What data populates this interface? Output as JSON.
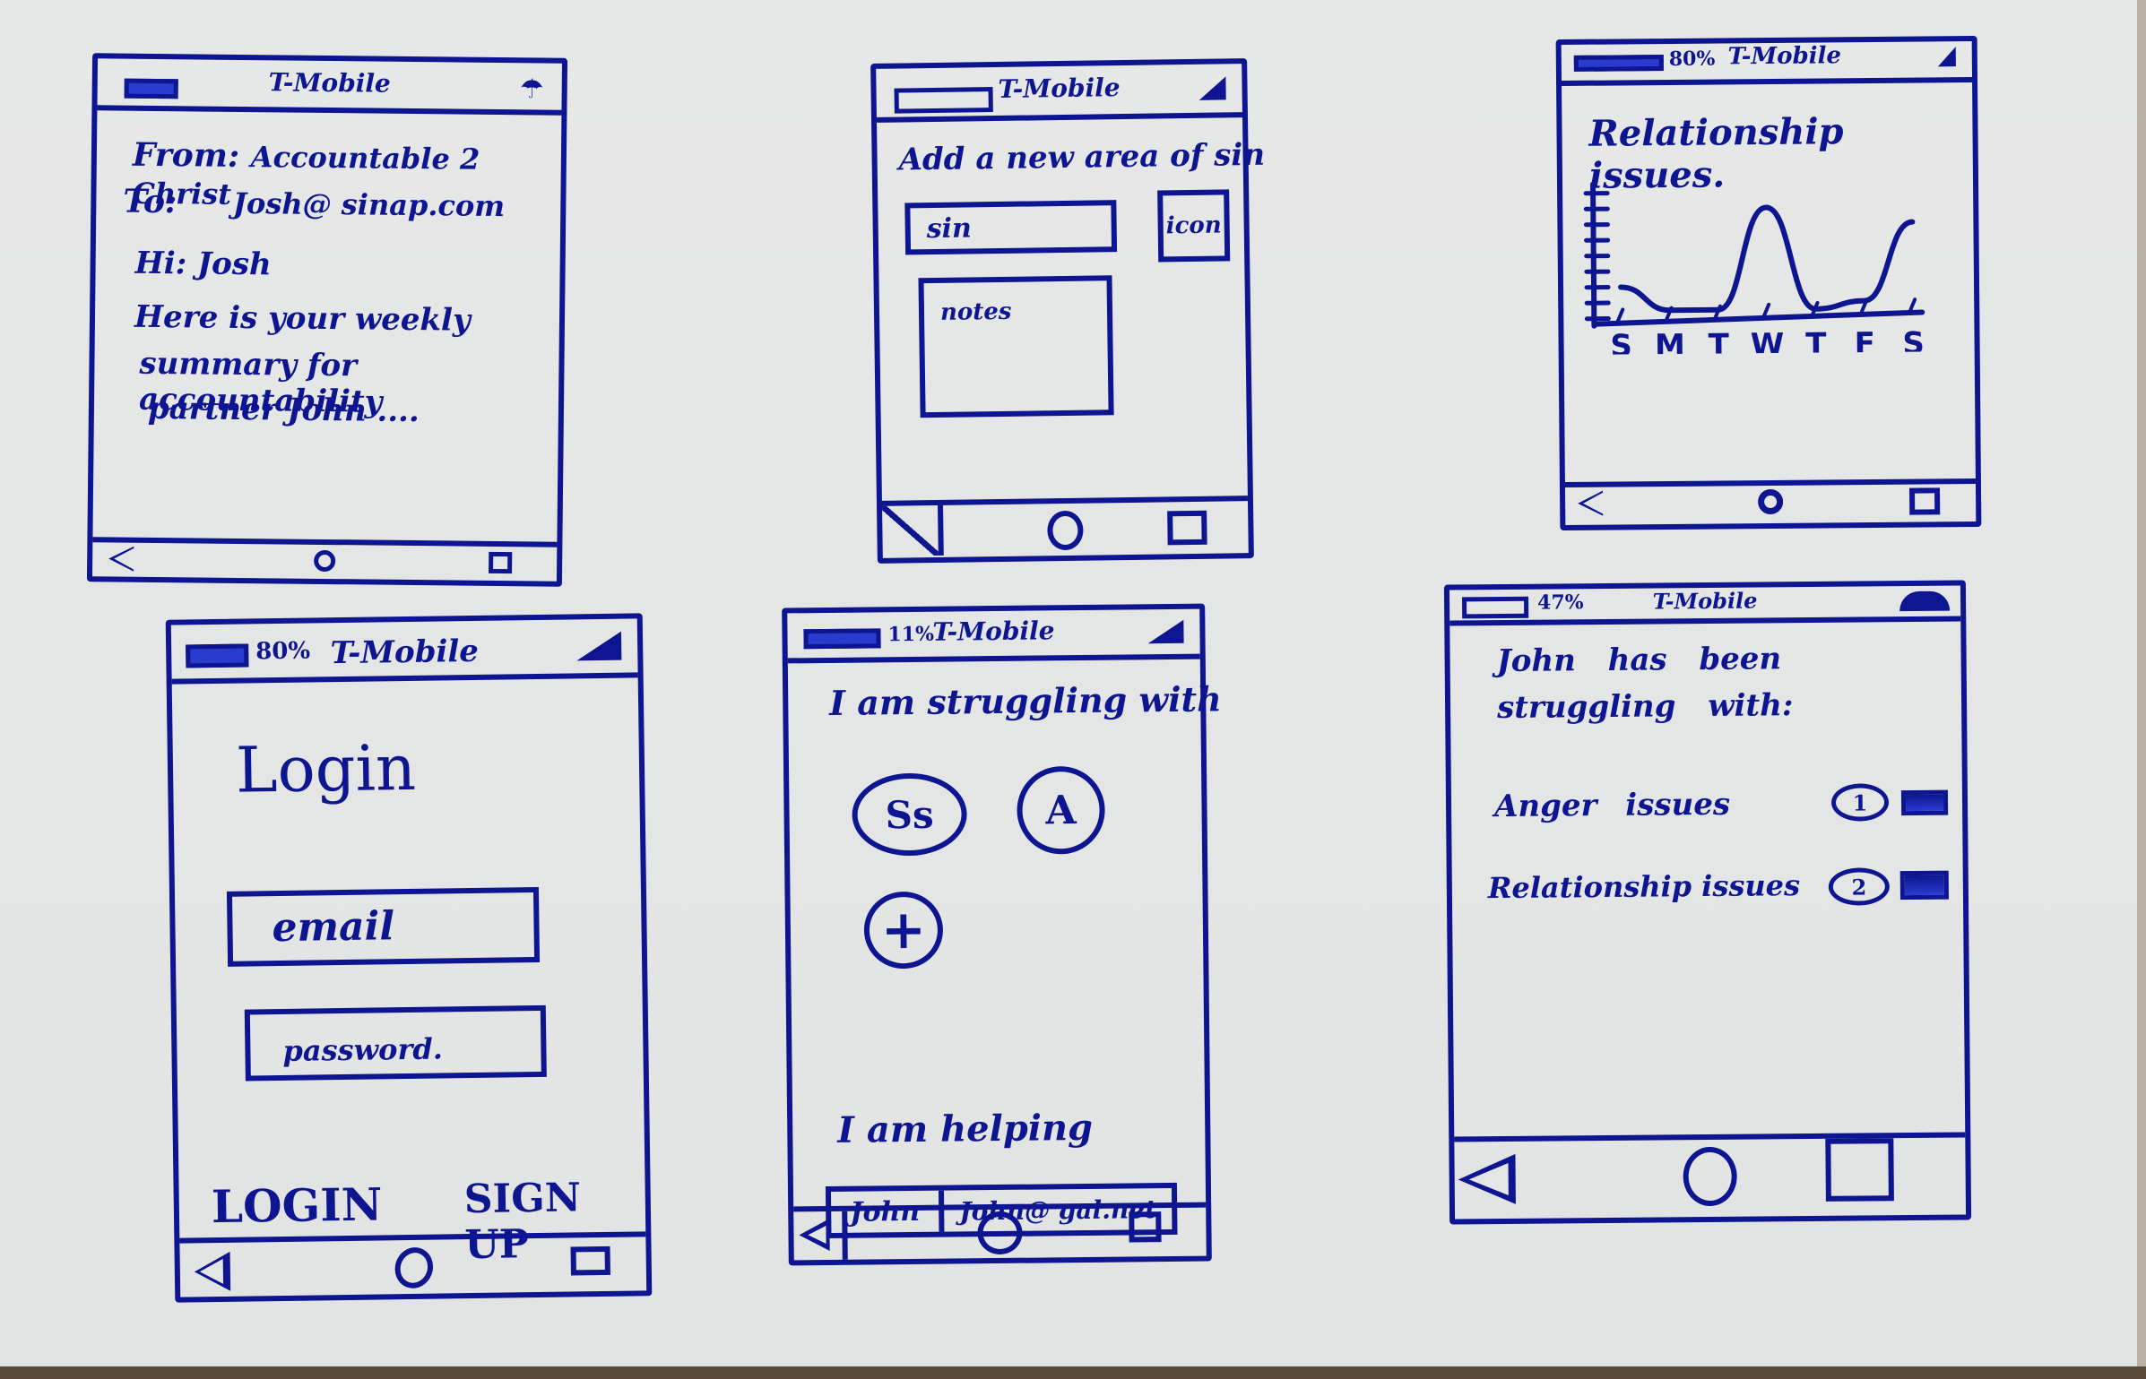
{
  "board": {
    "description": "Whiteboard wireframe sketches of a mobile accountability app"
  },
  "status_bar": {
    "carrier": "T-Mobile"
  },
  "nav_bar": {
    "back": "back-icon",
    "home": "home-icon",
    "recents": "recents-icon"
  },
  "screens": [
    {
      "id": "email-summary",
      "battery": "",
      "from_label": "From:",
      "from_value": "Accountable 2 Christ",
      "to_label": "To:",
      "to_value": "Josh@ sinap.com",
      "greeting": "Hi: Josh",
      "body": [
        "Here is your weekly",
        "summary for accountability",
        "partner John ...."
      ]
    },
    {
      "id": "add-area",
      "battery": "",
      "title": "Add a new area of sin",
      "name_input_value": "sin",
      "icon_button_label": "icon",
      "notes_placeholder": "notes"
    },
    {
      "id": "chart",
      "battery": "80%",
      "title": "Relationship issues."
    },
    {
      "id": "login",
      "battery": "80%",
      "title": "Login",
      "email_placeholder": "email",
      "password_placeholder": "password.",
      "login_button": "LOGIN",
      "signup_button": "SIGN UP"
    },
    {
      "id": "struggling",
      "battery": "11%",
      "struggling_heading": "I am struggling with",
      "areas": [
        {
          "label": "Ss",
          "name": "sexual-sin"
        },
        {
          "label": "A",
          "name": "anger"
        }
      ],
      "add_label": "+",
      "helping_heading": "I am helping",
      "helping_row": {
        "name": "John",
        "email": "John@ gal.net"
      }
    },
    {
      "id": "partner-summary",
      "battery": "47%",
      "heading": "John has been struggling with:",
      "issues": [
        {
          "label": "Anger issues",
          "count": "1"
        },
        {
          "label": "Relationship issues",
          "count": "2"
        }
      ]
    }
  ],
  "chart_data": {
    "type": "line",
    "title": "Relationship issues.",
    "categories": [
      "S",
      "M",
      "T",
      "W",
      "T",
      "F",
      "S"
    ],
    "series": [
      {
        "name": "Relationship issues",
        "values": [
          2,
          0.5,
          0.5,
          7,
          0.5,
          1,
          6
        ]
      }
    ],
    "xlabel": "",
    "ylabel": "",
    "ylim": [
      0,
      8
    ],
    "grid": false,
    "legend": "none"
  }
}
